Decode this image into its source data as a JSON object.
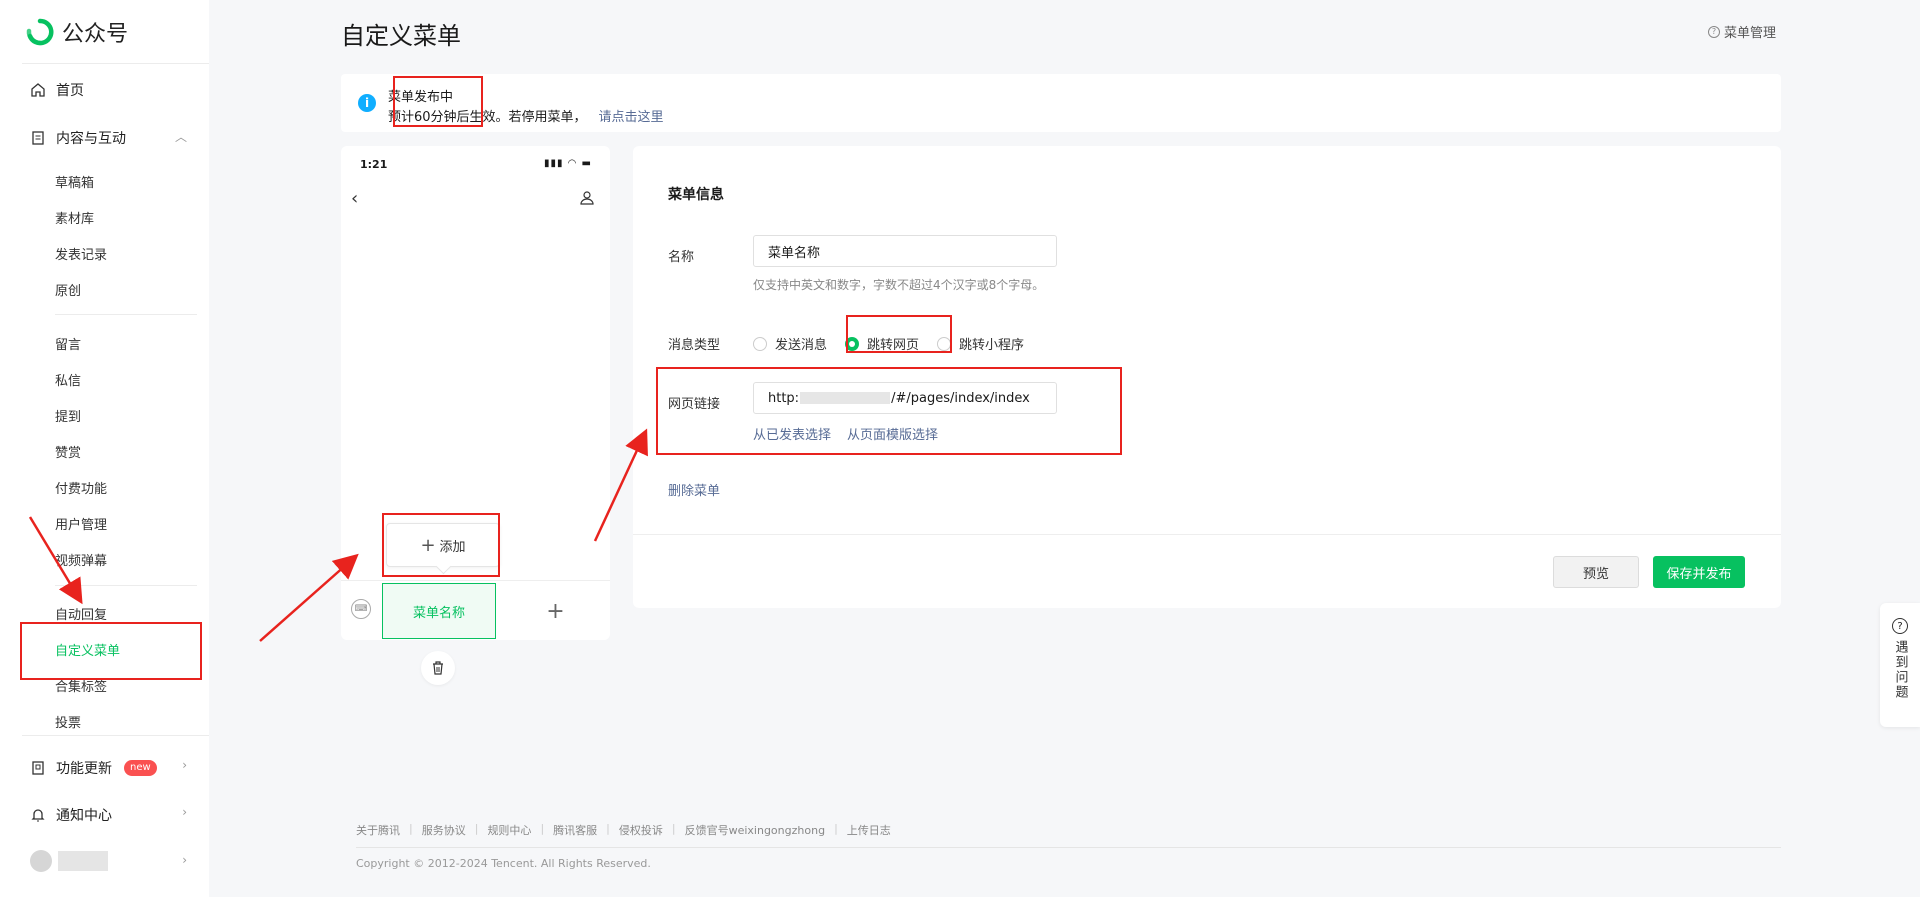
{
  "brand": {
    "name": "公众号"
  },
  "sidebar": {
    "home": "首页",
    "content_section": "内容与互动",
    "content_items": [
      "草稿箱",
      "素材库",
      "发表记录",
      "原创"
    ],
    "interaction_items": [
      "留言",
      "私信",
      "提到",
      "赞赏",
      "付费功能",
      "用户管理",
      "视频弹幕"
    ],
    "menu_items": [
      "自动回复",
      "自定义菜单",
      "合集标签",
      "投票"
    ],
    "feature_update": "功能更新",
    "new_badge": "new",
    "notify": "通知中心"
  },
  "header": {
    "title": "自定义菜单",
    "right_link": "菜单管理",
    "help_glyph": "?"
  },
  "notice": {
    "title": "菜单发布中",
    "desc": "预计60分钟后生效。若停用菜单，",
    "link": "请点击这里"
  },
  "phone": {
    "time": "1:21",
    "status": "▮▮▮ ◠ ▬",
    "add_label": "添加",
    "menu_tab": "菜单名称"
  },
  "panel": {
    "title": "菜单信息",
    "name_label": "名称",
    "name_value": "菜单名称",
    "name_hint": "仅支持中英文和数字，字数不超过4个汉字或8个字母。",
    "msg_type_label": "消息类型",
    "radio_send": "发送消息",
    "radio_web": "跳转网页",
    "radio_mini": "跳转小程序",
    "url_label": "网页链接",
    "url_prefix": "http:",
    "url_suffix": "/#/pages/index/index",
    "link_published": "从已发表选择",
    "link_template": "从页面模版选择",
    "delete_menu": "删除菜单",
    "btn_preview": "预览",
    "btn_save": "保存并发布"
  },
  "float_help": {
    "glyph": "?",
    "text": "遇到问题"
  },
  "footer": {
    "links": [
      "关于腾讯",
      "服务协议",
      "规则中心",
      "腾讯客服",
      "侵权投诉",
      "反馈官号weixingongzhong",
      "上传日志"
    ],
    "copyright": "Copyright © 2012-2024 Tencent. All Rights Reserved."
  },
  "colors": {
    "brand_green": "#07c160",
    "link_blue": "#576b95",
    "annotation_red": "#e8231e",
    "info_blue": "#10aeff"
  }
}
